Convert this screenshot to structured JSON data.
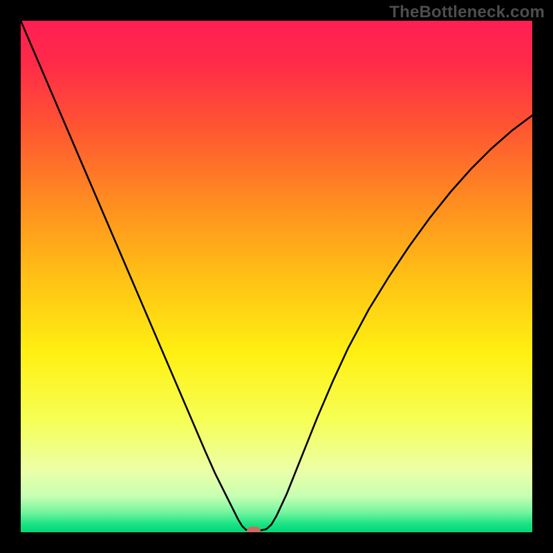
{
  "watermark": "TheBottleneck.com",
  "chart_data": {
    "type": "line",
    "title": "",
    "xlabel": "",
    "ylabel": "",
    "xlim": [
      0,
      100
    ],
    "ylim": [
      0,
      100
    ],
    "background_gradient": {
      "stops": [
        {
          "offset": 0.0,
          "color": "#ff1f53"
        },
        {
          "offset": 0.08,
          "color": "#ff2a49"
        },
        {
          "offset": 0.2,
          "color": "#ff5233"
        },
        {
          "offset": 0.35,
          "color": "#ff8b21"
        },
        {
          "offset": 0.5,
          "color": "#ffc015"
        },
        {
          "offset": 0.65,
          "color": "#fff012"
        },
        {
          "offset": 0.78,
          "color": "#f6ff55"
        },
        {
          "offset": 0.88,
          "color": "#ecffa8"
        },
        {
          "offset": 0.93,
          "color": "#c6ffb2"
        },
        {
          "offset": 0.96,
          "color": "#77f59f"
        },
        {
          "offset": 0.985,
          "color": "#18e283"
        },
        {
          "offset": 1.0,
          "color": "#00d878"
        }
      ]
    },
    "series": [
      {
        "name": "curve",
        "color": "#000000",
        "stroke_width": 2.6,
        "x": [
          0.0,
          3.0,
          6.0,
          9.0,
          12.0,
          15.0,
          18.0,
          21.0,
          24.0,
          27.0,
          30.0,
          33.0,
          36.0,
          38.0,
          40.0,
          41.5,
          42.5,
          43.3,
          44.0,
          45.0,
          46.5,
          48.0,
          49.0,
          50.0,
          52.0,
          55.0,
          58.0,
          61.0,
          64.0,
          68.0,
          72.0,
          76.0,
          80.0,
          84.0,
          88.0,
          92.0,
          96.0,
          100.0
        ],
        "y": [
          100.0,
          93.0,
          86.0,
          79.0,
          72.0,
          65.0,
          58.0,
          51.0,
          44.0,
          37.0,
          30.0,
          23.0,
          16.0,
          11.5,
          7.5,
          4.5,
          2.5,
          1.2,
          0.5,
          0.3,
          0.3,
          0.6,
          1.5,
          3.2,
          7.5,
          15.0,
          22.5,
          29.5,
          36.0,
          43.5,
          50.0,
          56.0,
          61.5,
          66.5,
          71.0,
          75.0,
          78.5,
          81.5
        ]
      }
    ],
    "marker": {
      "x": 45.5,
      "y": 0.3,
      "color": "#cc6a60"
    }
  }
}
